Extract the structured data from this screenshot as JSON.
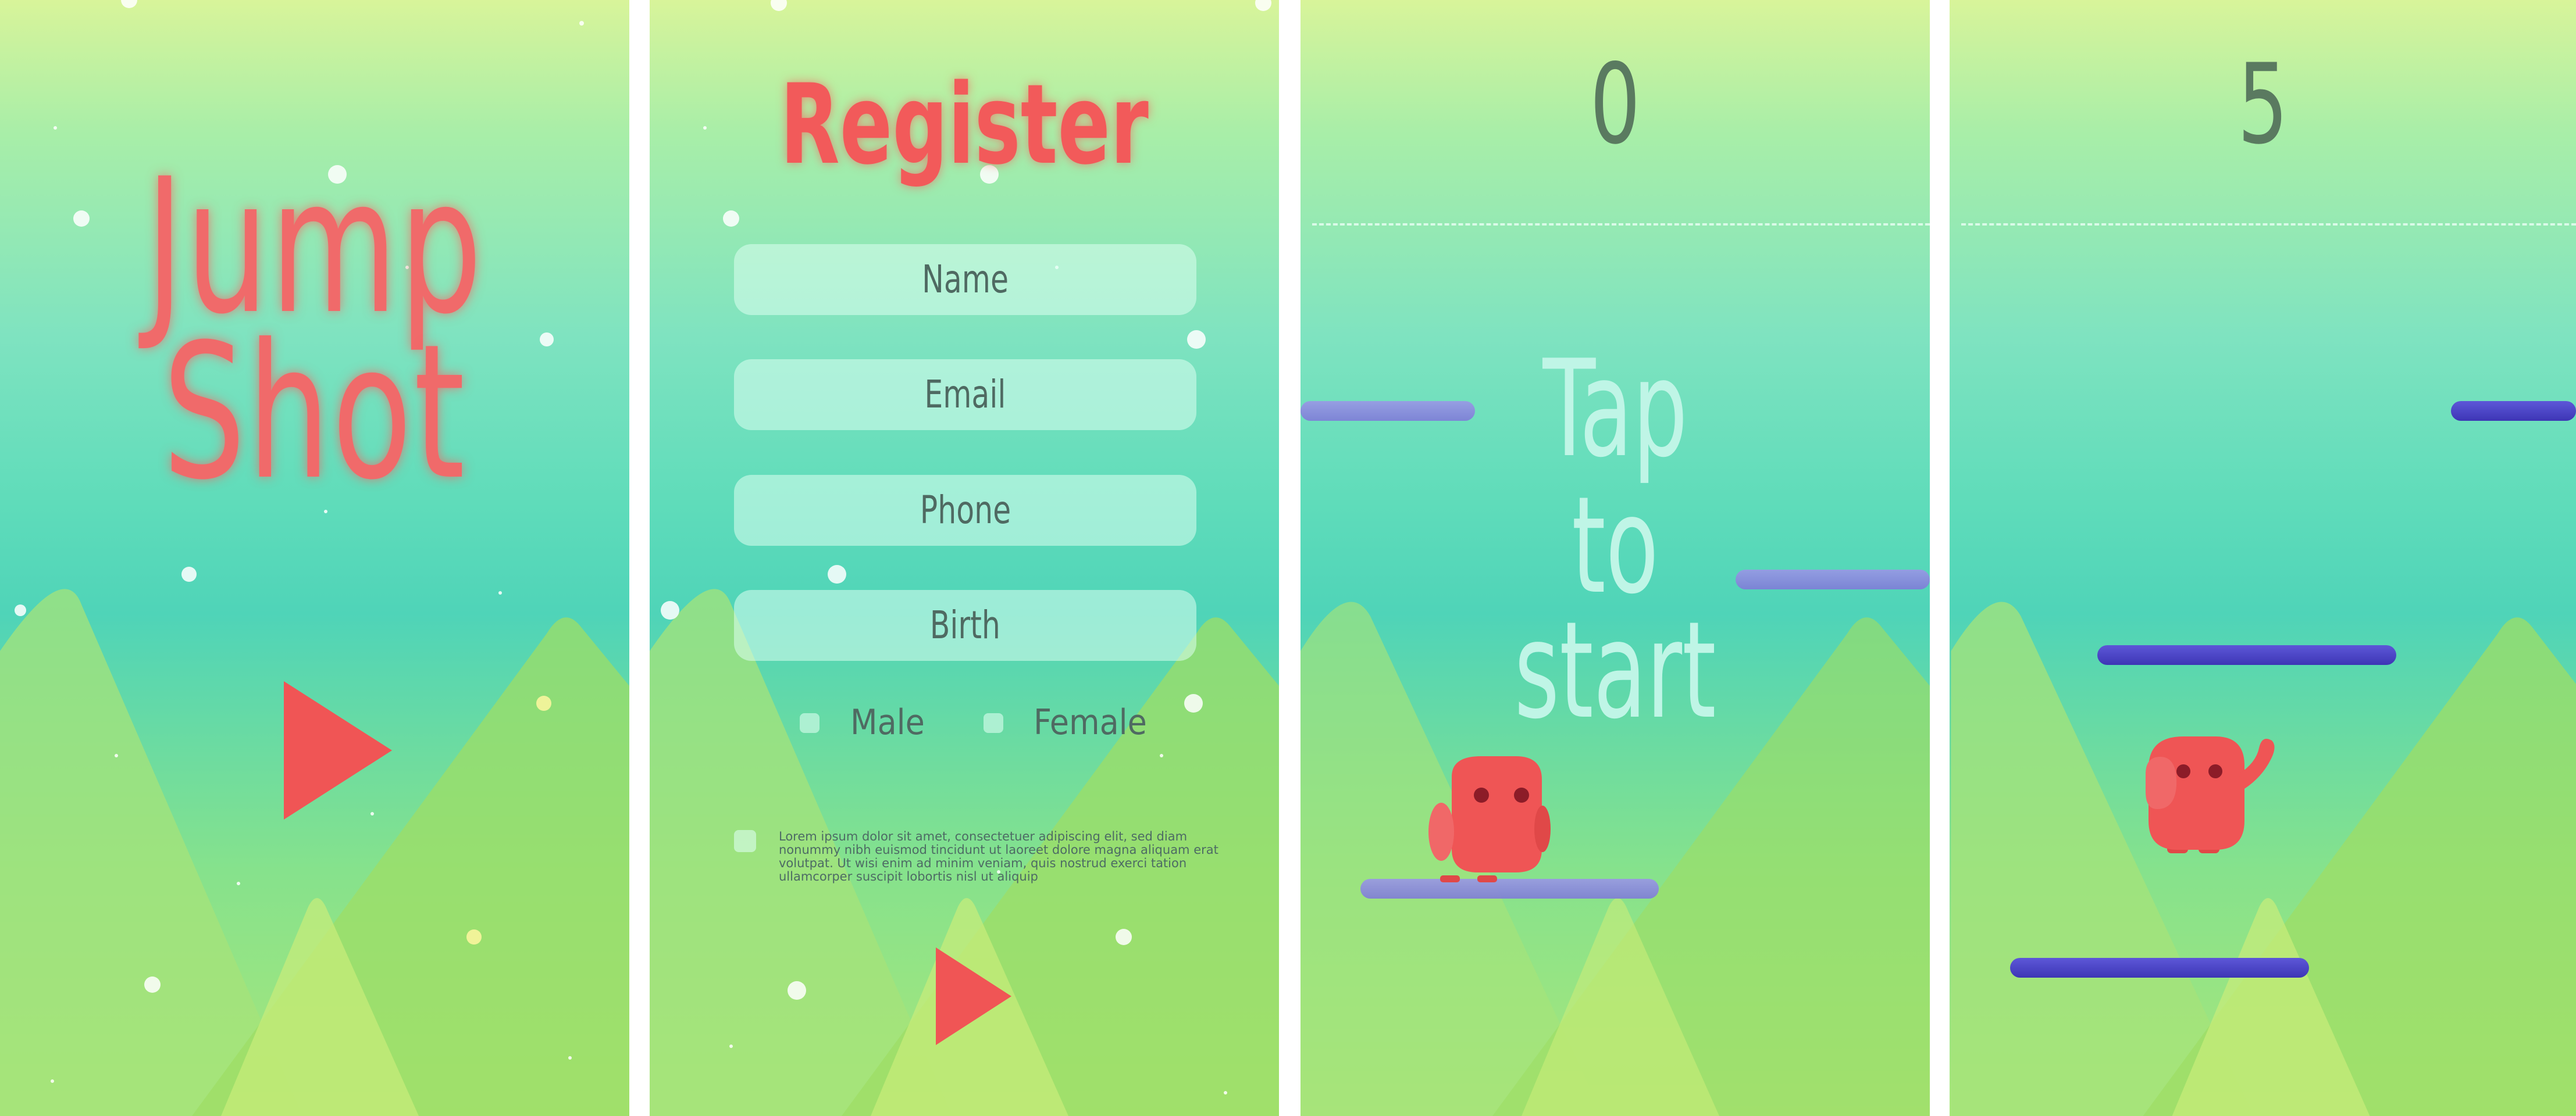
{
  "screens": {
    "splash": {
      "title_line1": "Jump",
      "title_line2": "Shot",
      "play_icon": "play-icon"
    },
    "register": {
      "title": "Register",
      "fields": [
        {
          "placeholder": "Name"
        },
        {
          "placeholder": "Email"
        },
        {
          "placeholder": "Phone"
        },
        {
          "placeholder": "Birth"
        }
      ],
      "gender_options": [
        "Male",
        "Female"
      ],
      "terms_text": "Lorem ipsum dolor sit amet, consectetuer adipiscing elit, sed diam nonummy nibh euismod tincidunt ut laoreet dolore magna aliquam erat volutpat. Ut wisi enim ad minim veniam, quis nostrud exerci tation ullamcorper suscipit lobortis nisl ut aliquip",
      "play_icon": "play-icon"
    },
    "start": {
      "score": "0",
      "prompt_line1": "Tap",
      "prompt_line2": "to",
      "prompt_line3": "start"
    },
    "game": {
      "score": "5"
    }
  },
  "colors": {
    "accent_red": "#f25a5a",
    "platform_blue": "#4b45c8",
    "score_green": "#5a7a60",
    "field_bg": "#d6fbee",
    "mountain_green": "#9ee06a"
  }
}
